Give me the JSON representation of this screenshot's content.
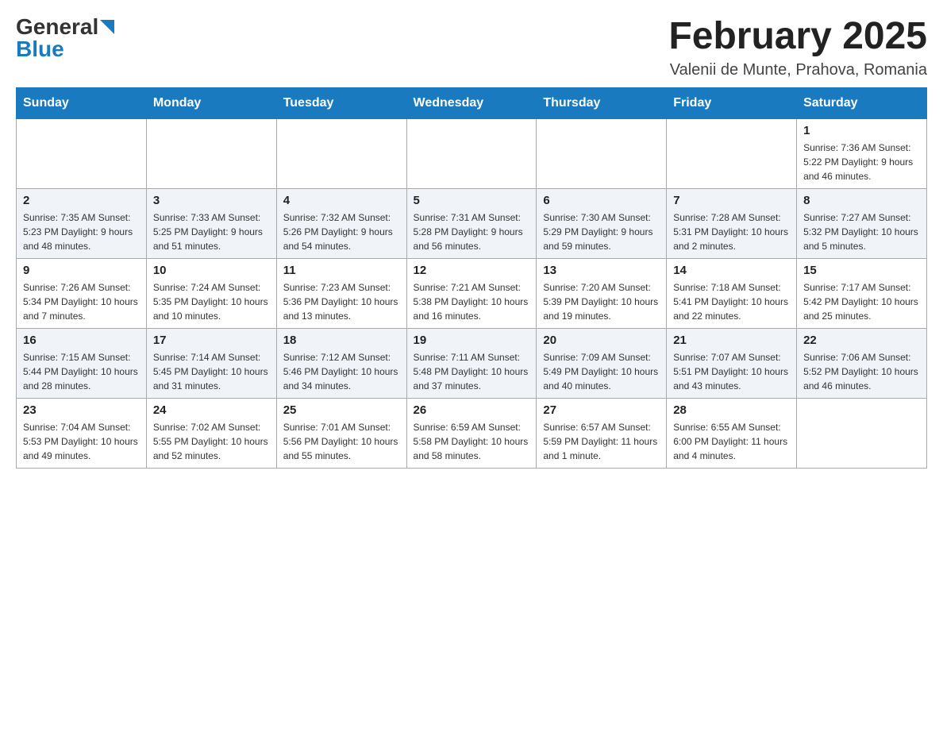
{
  "logo": {
    "general": "General",
    "blue": "Blue"
  },
  "header": {
    "month": "February 2025",
    "location": "Valenii de Munte, Prahova, Romania"
  },
  "weekdays": [
    "Sunday",
    "Monday",
    "Tuesday",
    "Wednesday",
    "Thursday",
    "Friday",
    "Saturday"
  ],
  "weeks": [
    {
      "days": [
        {
          "num": "",
          "info": ""
        },
        {
          "num": "",
          "info": ""
        },
        {
          "num": "",
          "info": ""
        },
        {
          "num": "",
          "info": ""
        },
        {
          "num": "",
          "info": ""
        },
        {
          "num": "",
          "info": ""
        },
        {
          "num": "1",
          "info": "Sunrise: 7:36 AM\nSunset: 5:22 PM\nDaylight: 9 hours\nand 46 minutes."
        }
      ]
    },
    {
      "days": [
        {
          "num": "2",
          "info": "Sunrise: 7:35 AM\nSunset: 5:23 PM\nDaylight: 9 hours\nand 48 minutes."
        },
        {
          "num": "3",
          "info": "Sunrise: 7:33 AM\nSunset: 5:25 PM\nDaylight: 9 hours\nand 51 minutes."
        },
        {
          "num": "4",
          "info": "Sunrise: 7:32 AM\nSunset: 5:26 PM\nDaylight: 9 hours\nand 54 minutes."
        },
        {
          "num": "5",
          "info": "Sunrise: 7:31 AM\nSunset: 5:28 PM\nDaylight: 9 hours\nand 56 minutes."
        },
        {
          "num": "6",
          "info": "Sunrise: 7:30 AM\nSunset: 5:29 PM\nDaylight: 9 hours\nand 59 minutes."
        },
        {
          "num": "7",
          "info": "Sunrise: 7:28 AM\nSunset: 5:31 PM\nDaylight: 10 hours\nand 2 minutes."
        },
        {
          "num": "8",
          "info": "Sunrise: 7:27 AM\nSunset: 5:32 PM\nDaylight: 10 hours\nand 5 minutes."
        }
      ]
    },
    {
      "days": [
        {
          "num": "9",
          "info": "Sunrise: 7:26 AM\nSunset: 5:34 PM\nDaylight: 10 hours\nand 7 minutes."
        },
        {
          "num": "10",
          "info": "Sunrise: 7:24 AM\nSunset: 5:35 PM\nDaylight: 10 hours\nand 10 minutes."
        },
        {
          "num": "11",
          "info": "Sunrise: 7:23 AM\nSunset: 5:36 PM\nDaylight: 10 hours\nand 13 minutes."
        },
        {
          "num": "12",
          "info": "Sunrise: 7:21 AM\nSunset: 5:38 PM\nDaylight: 10 hours\nand 16 minutes."
        },
        {
          "num": "13",
          "info": "Sunrise: 7:20 AM\nSunset: 5:39 PM\nDaylight: 10 hours\nand 19 minutes."
        },
        {
          "num": "14",
          "info": "Sunrise: 7:18 AM\nSunset: 5:41 PM\nDaylight: 10 hours\nand 22 minutes."
        },
        {
          "num": "15",
          "info": "Sunrise: 7:17 AM\nSunset: 5:42 PM\nDaylight: 10 hours\nand 25 minutes."
        }
      ]
    },
    {
      "days": [
        {
          "num": "16",
          "info": "Sunrise: 7:15 AM\nSunset: 5:44 PM\nDaylight: 10 hours\nand 28 minutes."
        },
        {
          "num": "17",
          "info": "Sunrise: 7:14 AM\nSunset: 5:45 PM\nDaylight: 10 hours\nand 31 minutes."
        },
        {
          "num": "18",
          "info": "Sunrise: 7:12 AM\nSunset: 5:46 PM\nDaylight: 10 hours\nand 34 minutes."
        },
        {
          "num": "19",
          "info": "Sunrise: 7:11 AM\nSunset: 5:48 PM\nDaylight: 10 hours\nand 37 minutes."
        },
        {
          "num": "20",
          "info": "Sunrise: 7:09 AM\nSunset: 5:49 PM\nDaylight: 10 hours\nand 40 minutes."
        },
        {
          "num": "21",
          "info": "Sunrise: 7:07 AM\nSunset: 5:51 PM\nDaylight: 10 hours\nand 43 minutes."
        },
        {
          "num": "22",
          "info": "Sunrise: 7:06 AM\nSunset: 5:52 PM\nDaylight: 10 hours\nand 46 minutes."
        }
      ]
    },
    {
      "days": [
        {
          "num": "23",
          "info": "Sunrise: 7:04 AM\nSunset: 5:53 PM\nDaylight: 10 hours\nand 49 minutes."
        },
        {
          "num": "24",
          "info": "Sunrise: 7:02 AM\nSunset: 5:55 PM\nDaylight: 10 hours\nand 52 minutes."
        },
        {
          "num": "25",
          "info": "Sunrise: 7:01 AM\nSunset: 5:56 PM\nDaylight: 10 hours\nand 55 minutes."
        },
        {
          "num": "26",
          "info": "Sunrise: 6:59 AM\nSunset: 5:58 PM\nDaylight: 10 hours\nand 58 minutes."
        },
        {
          "num": "27",
          "info": "Sunrise: 6:57 AM\nSunset: 5:59 PM\nDaylight: 11 hours\nand 1 minute."
        },
        {
          "num": "28",
          "info": "Sunrise: 6:55 AM\nSunset: 6:00 PM\nDaylight: 11 hours\nand 4 minutes."
        },
        {
          "num": "",
          "info": ""
        }
      ]
    }
  ]
}
